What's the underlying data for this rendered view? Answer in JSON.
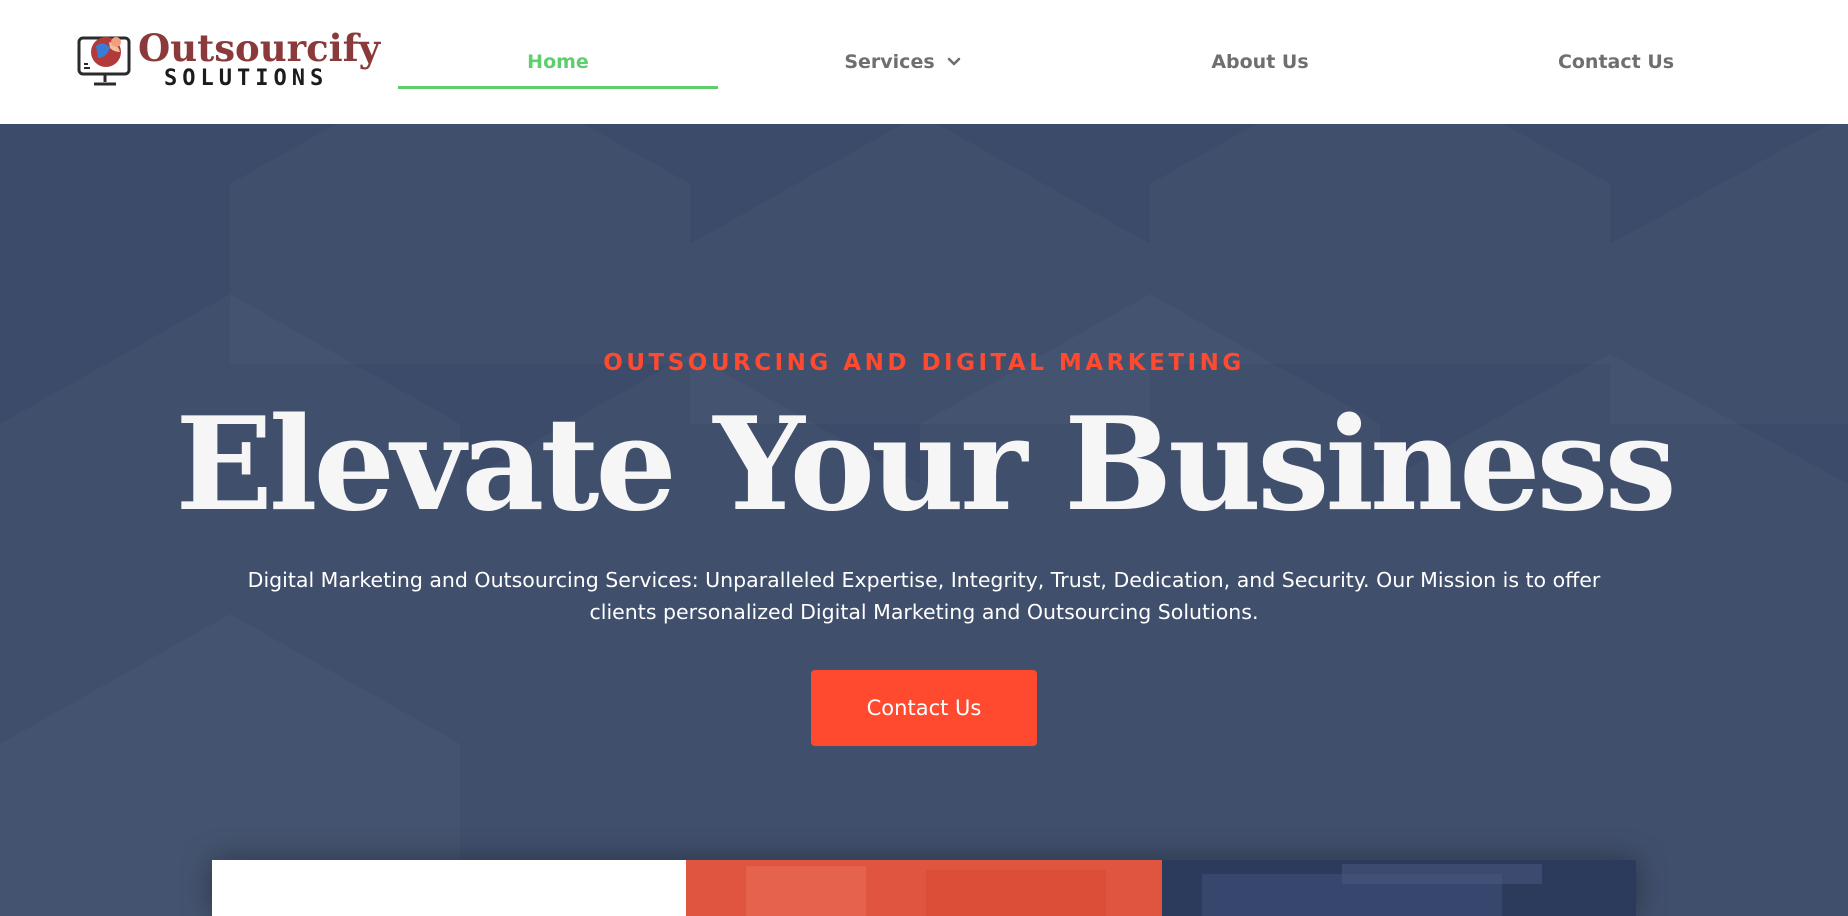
{
  "brand": {
    "name_line1": "Outsourcify",
    "name_line2": "SOLUTIONS"
  },
  "nav": {
    "home": "Home",
    "services": "Services",
    "about": "About Us",
    "contact": "Contact Us",
    "active": "Home"
  },
  "hero": {
    "eyebrow": "OUTSOURCING AND DIGITAL MARKETING",
    "headline": "Elevate Your Business",
    "subtext": "Digital Marketing and Outsourcing Services: Unparalleled Expertise, Integrity, Trust, Dedication, and Security. Our Mission is to offer clients personalized Digital Marketing and Outsourcing Solutions.",
    "cta_label": "Contact Us"
  },
  "colors": {
    "accent": "#ff4a30",
    "nav_active": "#5fcf6e",
    "hero_bg": "#3c4b69",
    "brand_red": "#8a3a3a"
  },
  "icons": {
    "logo": "computer-monitor-globe-logo-icon",
    "services_dropdown": "chevron-down-icon"
  }
}
